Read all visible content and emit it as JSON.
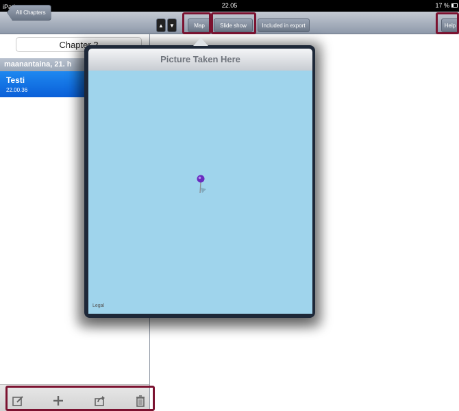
{
  "status_bar": {
    "left": "iPad ᯤ",
    "time": "22.05",
    "battery": "17 %"
  },
  "left_pane": {
    "back_button": "All Chapters",
    "chapter_field": "Chapter 2",
    "section_header": "maanantaina, 21. h",
    "selected_item": {
      "title": "Testi",
      "time": "22.00.36"
    },
    "toolbar_icons": [
      "compose-icon",
      "add-icon",
      "share-icon",
      "trash-icon"
    ]
  },
  "right_toolbar": {
    "up": "▲",
    "down": "▼",
    "map": "Map",
    "slideshow": "Slide show",
    "export": "Included in export",
    "help": "Help"
  },
  "popover": {
    "title": "Picture Taken Here",
    "legal": "Legal",
    "map_color": "#9fd4ec",
    "pin_color": "#6a2bbf"
  },
  "colors": {
    "highlight": "#7b1230",
    "selection": "#1473e6"
  }
}
